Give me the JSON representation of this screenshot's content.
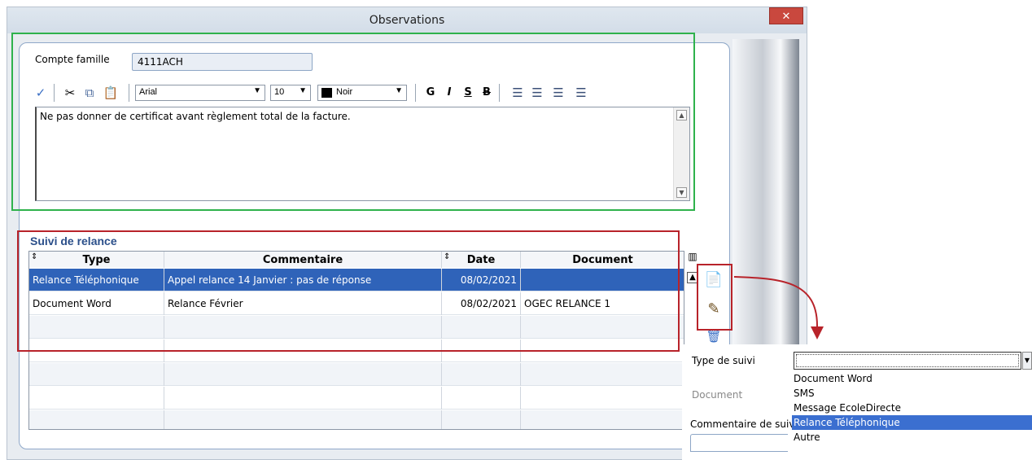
{
  "window": {
    "title": "Observations",
    "close_label": "✕"
  },
  "account": {
    "label": "Compte famille",
    "value": "4111ACH"
  },
  "toolbar": {
    "font_name": "Arial",
    "font_size": "10",
    "color_name": "Noir",
    "bold": "G",
    "italic": "I",
    "underline": "S",
    "strike": "B"
  },
  "editor": {
    "text": "Ne pas donner de certificat avant règlement total de la facture."
  },
  "suivi": {
    "title": "Suivi de relance",
    "columns": [
      "Type",
      "Commentaire",
      "Date",
      "Document"
    ],
    "rows": [
      {
        "type": "Relance Téléphonique",
        "commentaire": "Appel relance 14 Janvier : pas de réponse",
        "date": "08/02/2021",
        "document": ""
      },
      {
        "type": "Document Word",
        "commentaire": "Relance Février",
        "date": "08/02/2021",
        "document": "OGEC RELANCE 1"
      }
    ]
  },
  "popup": {
    "type_label": "Type de suivi",
    "document_label": "Document",
    "comment_label": "Commentaire de suivi",
    "type_value": "",
    "options": [
      "Document Word",
      "SMS",
      "Message EcoleDirecte",
      "Relance Téléphonique",
      "Autre"
    ],
    "highlighted_option": "Relance Téléphonique"
  },
  "colors": {
    "highlight_green": "#2fb24c",
    "highlight_red": "#b8232a",
    "selection_blue": "#2f63b9",
    "title_blue": "#2b4f8a"
  }
}
